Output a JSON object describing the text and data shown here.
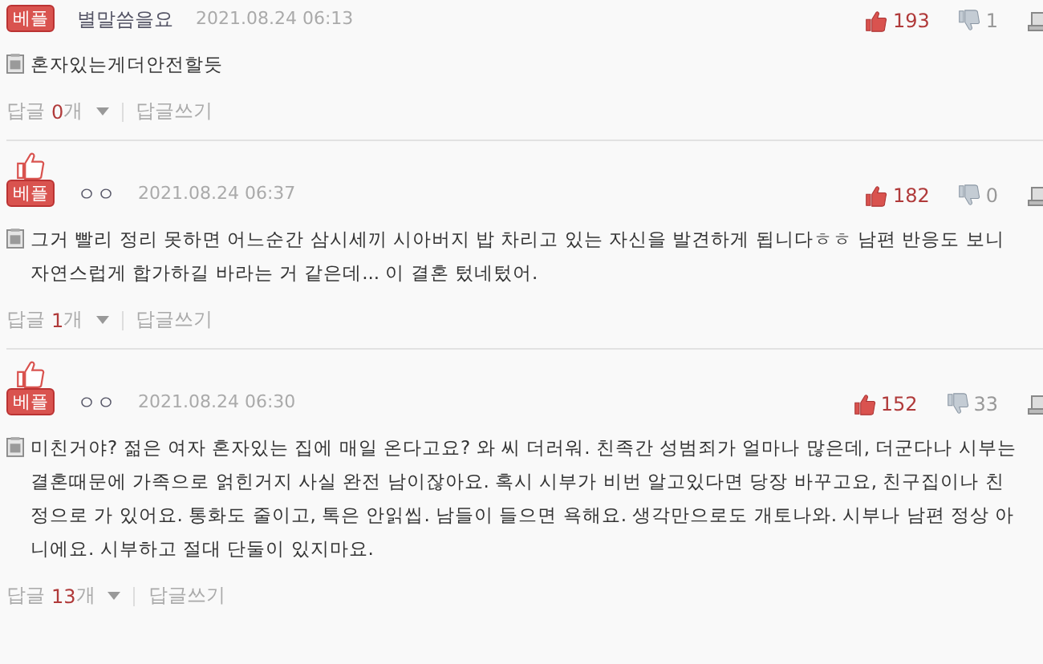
{
  "comments": [
    {
      "best_badge": "베플",
      "show_thumb_mark": false,
      "author": "별말씀을요",
      "date": "2021.08.24 06:13",
      "likes": "193",
      "dislikes": "1",
      "body": "혼자있는게더안전할듯",
      "replies_label": "답글",
      "replies_count": "0",
      "replies_unit": "개",
      "write_reply": "답글쓰기"
    },
    {
      "best_badge": "베플",
      "show_thumb_mark": true,
      "author": "ㅇㅇ",
      "date": "2021.08.24 06:37",
      "likes": "182",
      "dislikes": "0",
      "body": "그거 빨리 정리 못하면 어느순간 삼시세끼 시아버지 밥 차리고 있는 자신을 발견하게 됩니다ㅎㅎ 남편 반응도 보니 자연스럽게 합가하길 바라는 거 같은데... 이 결혼 텄네텄어.",
      "replies_label": "답글",
      "replies_count": "1",
      "replies_unit": "개",
      "write_reply": "답글쓰기"
    },
    {
      "best_badge": "베플",
      "show_thumb_mark": true,
      "author": "ㅇㅇ",
      "date": "2021.08.24 06:30",
      "likes": "152",
      "dislikes": "33",
      "body": "미친거야? 젊은 여자 혼자있는 집에 매일 온다고요? 와 씨 더러워. 친족간 성범죄가 얼마나 많은데, 더군다나 시부는 결혼때문에 가족으로 얽힌거지 사실 완전 남이잖아요. 혹시 시부가 비번 알고있다면 당장 바꾸고요, 친구집이나 친정으로 가 있어요. 통화도 줄이고, 톡은 안읽씹. 남들이 들으면 욕해요. 생각만으로도 개토나와. 시부나 남편 정상 아니에요. 시부하고 절대 단둘이 있지마요.",
      "replies_label": "답글",
      "replies_count": "13",
      "replies_unit": "개",
      "write_reply": "답글쓰기"
    }
  ]
}
